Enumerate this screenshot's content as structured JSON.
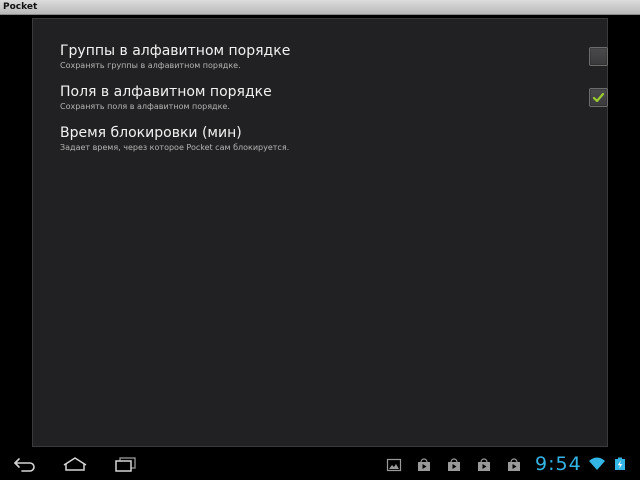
{
  "window": {
    "title": "Pocket"
  },
  "preferences": [
    {
      "title": "Группы в алфавитном порядке",
      "summary": "Сохранять группы в алфавитном порядке.",
      "checked": false
    },
    {
      "title": "Поля в алфавитном порядке",
      "summary": "Сохранять поля в алфавитном порядке.",
      "checked": true
    },
    {
      "title": "Время блокировки (мин)",
      "summary": "Задает время, через которое Pocket сам блокируется."
    }
  ],
  "status_bar": {
    "time": "9:54",
    "accent_color": "#33b5e5",
    "check_color": "#9ccc2f",
    "notification_icons": [
      "gallery-icon",
      "play-store-icon",
      "play-store-icon",
      "play-store-icon",
      "play-store-icon"
    ]
  },
  "nav": [
    "back-icon",
    "home-icon",
    "recent-apps-icon"
  ]
}
